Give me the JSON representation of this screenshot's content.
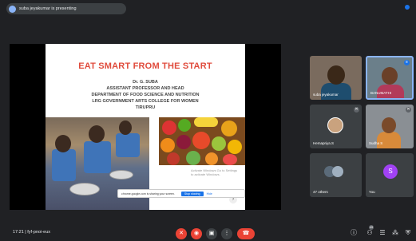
{
  "banner": {
    "presenter": "suba jeyakumar is presenting"
  },
  "slide": {
    "title": "EAT SMART FROM THE START",
    "author": "Dr. G. SUBA",
    "lines": [
      "ASSISTANT PROFESSOR AND HEAD",
      "DEPARTMENT OF FOOD SCIENCE AND NUTRITION",
      "LRG GOVERNMENT ARTS COLLEGE FOR WOMEN",
      "TIRUPRU"
    ],
    "watermark": "Activate Windows Go to Settings to activate Windows.",
    "share_bar": {
      "message": "chrome.google.com is sharing your screen.",
      "stop_label": "Stop sharing",
      "hide_label": "Hide"
    }
  },
  "participants": [
    {
      "name": "suba jeyakumar",
      "type": "video",
      "muted": false
    },
    {
      "name": "BANUMATHI",
      "type": "video",
      "muted": false,
      "highlighted": true
    },
    {
      "name": "Hemapriya.S",
      "type": "avatar-photo",
      "muted": true
    },
    {
      "name": "Sudha S",
      "type": "video",
      "muted": true
    },
    {
      "name": "47 others",
      "type": "group"
    },
    {
      "name": "You",
      "type": "avatar-letter",
      "initial": "S",
      "avatar_color": "#a142f4"
    }
  ],
  "bottom_bar": {
    "time": "17:21",
    "separator": "|",
    "meeting_code": "fyf-pnoi-eux",
    "participants_count": "49"
  }
}
